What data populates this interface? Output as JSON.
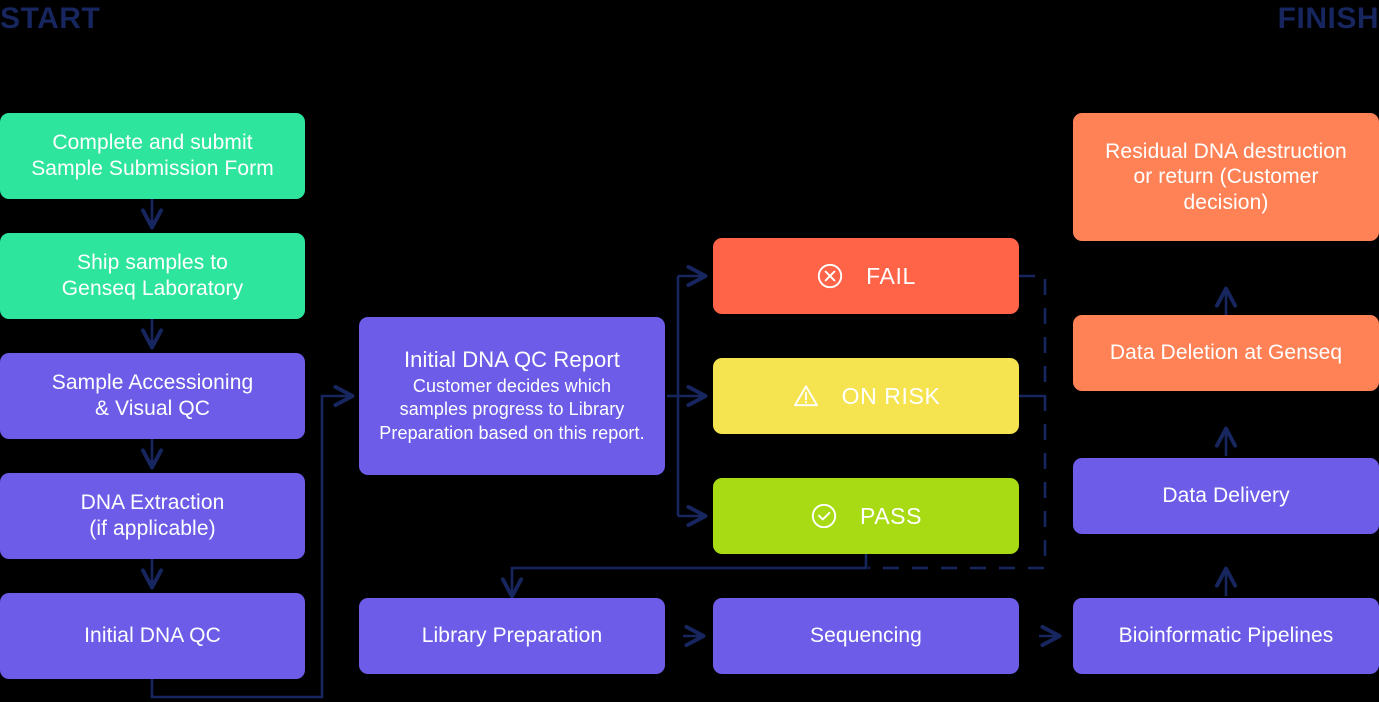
{
  "diagram": {
    "title_start": "START",
    "title_finish": "FINISH",
    "background": "#000000",
    "colors": {
      "green": "#2EE59D",
      "purple": "#6C5CE7",
      "red": "#FF6348",
      "yellow": "#F5E44F",
      "lime": "#A8DB14",
      "orange": "#FF8257",
      "connector": "#17265E",
      "label": "#17265E",
      "text": "#FFFFFF"
    }
  },
  "columns": {
    "intake": {
      "nodes": [
        {
          "id": "submit-form",
          "color": "green",
          "lines": [
            "Complete and submit",
            "Sample Submission Form"
          ]
        },
        {
          "id": "ship-samples",
          "color": "green",
          "lines": [
            "Ship samples to",
            "Genseq Laboratory"
          ]
        },
        {
          "id": "sample-accessioning",
          "color": "purple",
          "lines": [
            "Sample Accessioning",
            "& Visual QC"
          ]
        },
        {
          "id": "dna-extraction",
          "color": "purple",
          "lines": [
            "DNA Extraction",
            "(if applicable)"
          ]
        },
        {
          "id": "initial-dna-qc",
          "color": "purple",
          "lines": [
            "Initial DNA QC"
          ]
        }
      ]
    },
    "report": {
      "nodes": [
        {
          "id": "qc-report",
          "color": "purple",
          "title": "Initial DNA QC Report",
          "body": [
            "Customer decides which",
            "samples progress to Library",
            "Preparation based on this report."
          ]
        },
        {
          "id": "library-preparation",
          "color": "purple",
          "lines": [
            "Library Preparation"
          ]
        }
      ]
    },
    "outcomes": {
      "nodes": [
        {
          "id": "status-fail",
          "color": "red",
          "label": "FAIL",
          "icon": "circle-x-icon"
        },
        {
          "id": "status-on-risk",
          "color": "yellow",
          "label": "ON RISK",
          "icon": "warning-triangle-icon"
        },
        {
          "id": "status-pass",
          "color": "lime",
          "label": "PASS",
          "icon": "circle-check-icon"
        },
        {
          "id": "sequencing",
          "color": "purple",
          "lines": [
            "Sequencing"
          ]
        }
      ]
    },
    "delivery": {
      "nodes": [
        {
          "id": "residual-dna",
          "color": "orange",
          "lines": [
            "Residual DNA destruction",
            "or return (Customer",
            "decision)"
          ]
        },
        {
          "id": "data-deletion",
          "color": "orange",
          "lines": [
            "Data Deletion at Genseq"
          ]
        },
        {
          "id": "data-delivery",
          "color": "purple",
          "lines": [
            "Data Delivery"
          ]
        },
        {
          "id": "bioinformatic-pipelines",
          "color": "purple",
          "lines": [
            "Bioinformatic Pipelines"
          ]
        }
      ]
    }
  }
}
